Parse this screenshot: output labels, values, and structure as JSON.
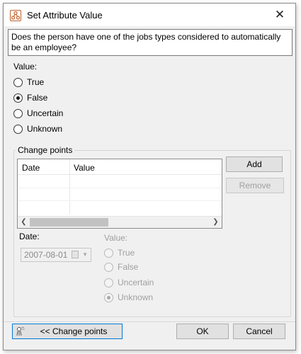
{
  "window": {
    "title": "Set Attribute Value",
    "close_glyph": "✕"
  },
  "question": "Does the person have one of the jobs types considered to automatically be an employee?",
  "value_section": {
    "label": "Value:",
    "options": [
      "True",
      "False",
      "Uncertain",
      "Unknown"
    ],
    "selected": "False"
  },
  "change_points": {
    "title": "Change points",
    "columns": [
      "Date",
      "Value"
    ],
    "rows": [],
    "add_label": "Add",
    "remove_label": "Remove"
  },
  "detail": {
    "date_label": "Date:",
    "date_value": "2007-08-01",
    "value_label": "Value:",
    "options": [
      "True",
      "False",
      "Uncertain",
      "Unknown"
    ],
    "selected": "Unknown"
  },
  "footer": {
    "toggle_label": "<< Change points",
    "ok_label": "OK",
    "cancel_label": "Cancel"
  },
  "icons": {
    "app": "attribute-network-icon",
    "close": "close-icon",
    "toggle": "wizard-icon",
    "calendar": "calendar-icon"
  },
  "colors": {
    "accent": "#0078d7",
    "window_bg": "#f0f0f0",
    "app_icon": "#c0612b"
  }
}
